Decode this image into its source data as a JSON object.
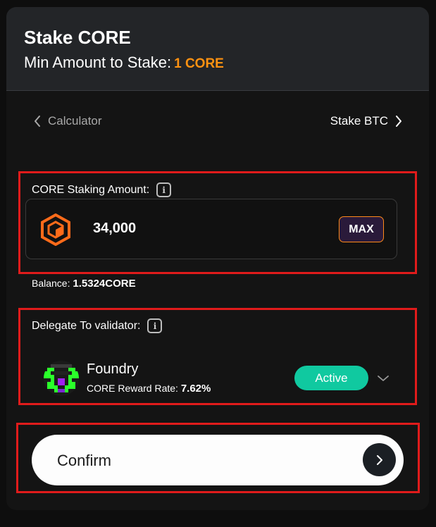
{
  "header": {
    "title": "Stake CORE",
    "min_label": "Min Amount to Stake:",
    "min_value": "1 CORE"
  },
  "nav": {
    "prev_label": "Calculator",
    "next_label": "Stake BTC"
  },
  "amount": {
    "label": "CORE Staking Amount:",
    "value": "34,000",
    "max_label": "MAX",
    "balance_label": "Balance:",
    "balance_value": "1.5324CORE"
  },
  "validator": {
    "label": "Delegate To validator:",
    "name": "Foundry",
    "reward_label": "CORE Reward Rate:",
    "reward_value": "7.62%",
    "status": "Active"
  },
  "confirm": {
    "label": "Confirm"
  },
  "colors": {
    "accent": "#ff9211",
    "active": "#10c9a0",
    "highlight": "#e01b1b"
  },
  "icons": [
    "chevron-left-icon",
    "chevron-right-icon",
    "info-icon",
    "core-logo-icon",
    "validator-avatar-icon",
    "chevron-down-icon",
    "arrow-right-icon"
  ]
}
